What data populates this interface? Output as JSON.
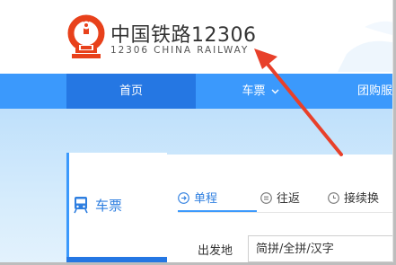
{
  "header": {
    "logo_icon": "china-railway-logo",
    "brand_cn": "中国铁路12306",
    "brand_en": "12306 CHINA RAILWAY",
    "logo_color": "#e8411b"
  },
  "nav": {
    "items": [
      {
        "label": "首页"
      },
      {
        "label": "车票"
      },
      {
        "label": "团购服"
      }
    ],
    "active_color": "#2577e3",
    "bar_color": "#3b99fc"
  },
  "sidebar": {
    "icon": "train-icon",
    "label": "车票"
  },
  "tabs": [
    {
      "label": "单程",
      "icon": "arrow-circle-icon"
    },
    {
      "label": "往返",
      "icon": "swap-circle-icon"
    },
    {
      "label": "接续换"
    }
  ],
  "form": {
    "from_label": "出发地",
    "from_placeholder": "简拼/全拼/汉字"
  },
  "annotation": {
    "arrow_color": "#e8402a"
  }
}
